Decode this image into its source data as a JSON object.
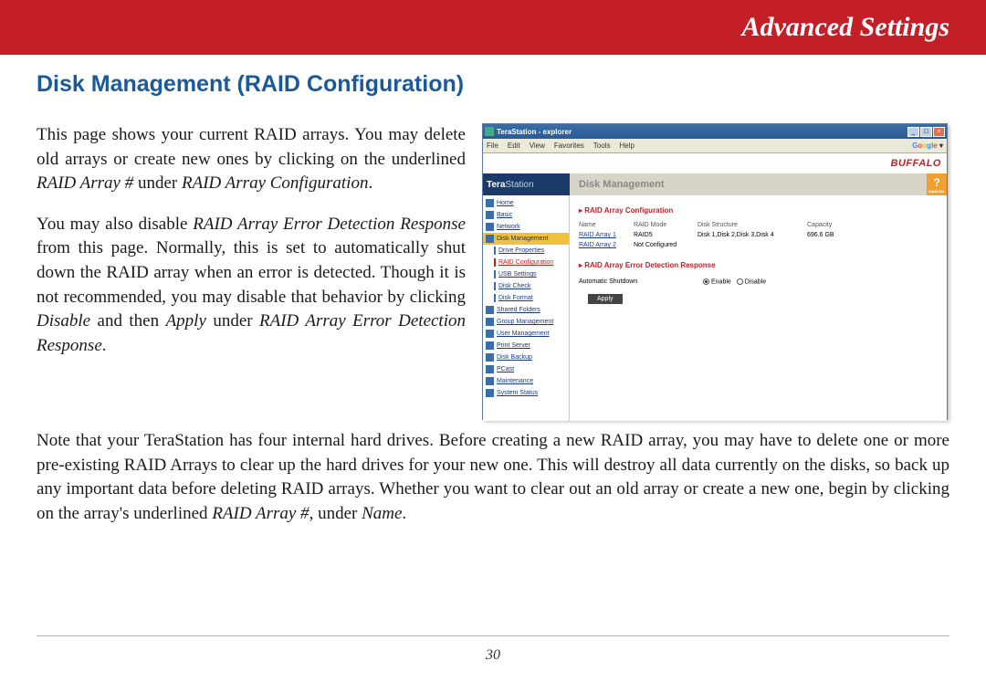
{
  "banner": {
    "title": "Advanced Settings"
  },
  "heading": "Disk Management (RAID Configuration)",
  "para1_a": "This page shows your current RAID arrays. You may delete old arrays or create new ones by clicking on the underlined ",
  "para1_b": "RAID Array #",
  "para1_c": " under ",
  "para1_d": "RAID Array Configuration",
  "para1_e": ".",
  "para2_a": "You may also disable ",
  "para2_b": "RAID Array Error Detection Response",
  "para2_c": " from this page.  Normally, this is set to automatically shut down the RAID array when an error is detected.  Though it is not recommended, you may disable that behavior by clicking ",
  "para2_d": "Disable",
  "para2_e": " and then ",
  "para2_f": "Apply",
  "para2_g": " under ",
  "para2_h": "RAID Array Error Detection Response",
  "para2_i": ".",
  "para3_a": "Note that your TeraStation has four internal hard drives.  Before creating a new RAID array, you may have to delete one or more pre-existing RAID Arrays to clear up the hard drives for your new one.  This will destroy all data currently on the disks, so back up any important data before deleting RAID arrays.  Whether you want to clear out an old array or create a new one, begin by clicking on the array's underlined ",
  "para3_b": "RAID Array #",
  "para3_c": ", under ",
  "para3_d": "Name",
  "para3_e": ".",
  "page_number": "30",
  "screenshot": {
    "window_title": "TeraStation - explorer",
    "menus": [
      "File",
      "Edit",
      "View",
      "Favorites",
      "Tools",
      "Help"
    ],
    "google": "Google",
    "brand": "BUFFALO",
    "logo_a": "Tera",
    "logo_b": "Station",
    "page_title": "Disk Management",
    "help": "?",
    "help_sub": "MANUAL",
    "sidebar": {
      "home": "Home",
      "basic": "Basic",
      "network": "Network",
      "disk_mgmt": "Disk Management",
      "drive_props": "Drive Properties",
      "raid_config": "RAID Configuration",
      "usb_settings": "USB Settings",
      "disk_check": "Disk Check",
      "disk_format": "Disk Format",
      "shared": "Shared Folders",
      "group_mgmt": "Group Management",
      "user_mgmt": "User Management",
      "print": "Print Server",
      "backup": "Disk Backup",
      "pcast": "PCast",
      "maint": "Maintenance",
      "status": "System Status"
    },
    "section1": "RAID Array Configuration",
    "cols": {
      "name": "Name",
      "mode": "RAID Mode",
      "struct": "Disk Structure",
      "cap": "Capacity"
    },
    "rows": [
      {
        "name": "RAID Array 1",
        "mode": "RAID5",
        "struct": "Disk 1,Disk 2,Disk 3,Disk 4",
        "cap": "696.6 GB"
      },
      {
        "name": "RAID Array 2",
        "mode": "Not Configured",
        "struct": "",
        "cap": ""
      }
    ],
    "section2": "RAID Array Error Detection Response",
    "autoshut": "Automatic Shutdown",
    "enable": "Enable",
    "disable": "Disable",
    "apply": "Apply"
  }
}
